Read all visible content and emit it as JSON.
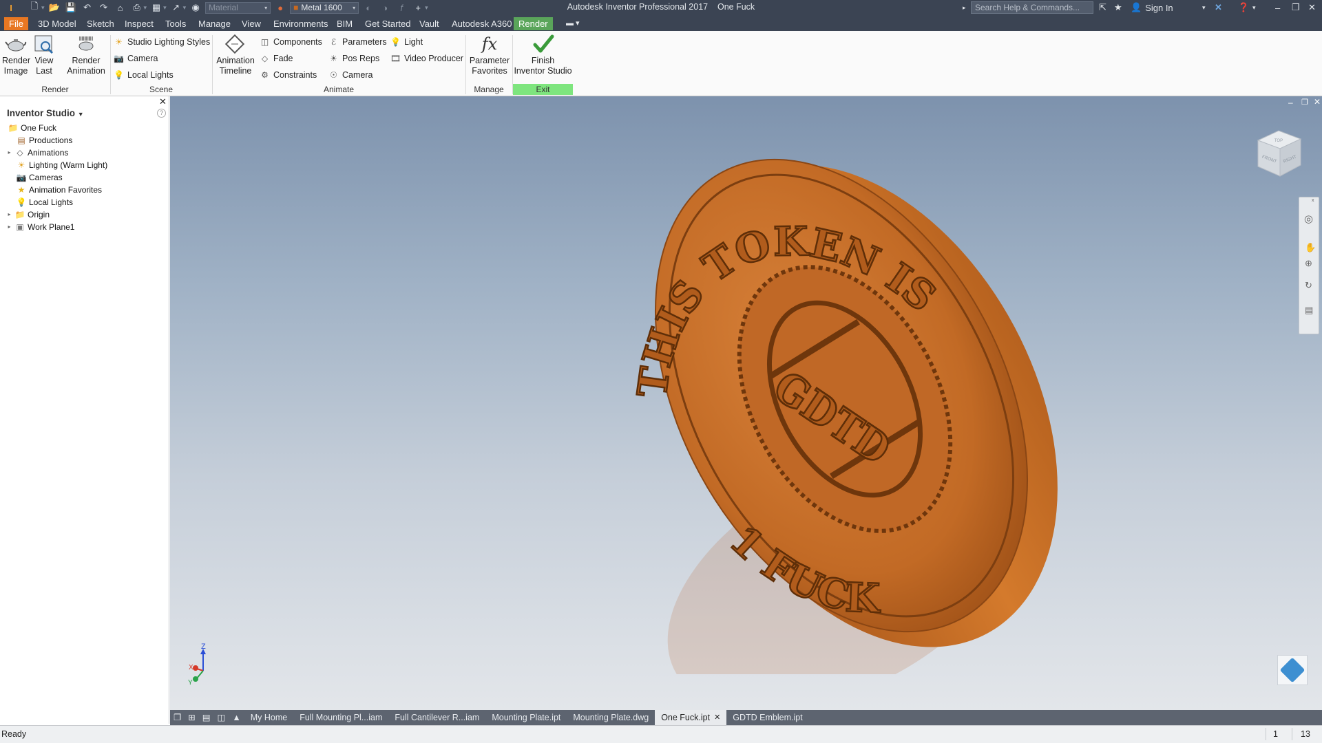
{
  "window": {
    "app_title": "Autodesk Inventor Professional 2017",
    "doc_title": "One Fuck"
  },
  "quick_access": {
    "material_placeholder": "Material",
    "appearance_value": "Metal 1600"
  },
  "search": {
    "placeholder": "Search Help & Commands..."
  },
  "account": {
    "sign_in": "Sign In"
  },
  "menu_tabs": [
    "File",
    "3D Model",
    "Sketch",
    "Inspect",
    "Tools",
    "Manage",
    "View",
    "Environments",
    "BIM",
    "Get Started",
    "Vault",
    "Autodesk A360",
    "Render"
  ],
  "active_tab": "Render",
  "ribbon": {
    "render_image": [
      "Render",
      "Image"
    ],
    "view_last": [
      "View",
      "Last"
    ],
    "render_animation": [
      "Render",
      "Animation"
    ],
    "studio_lighting_styles": "Studio Lighting Styles",
    "camera": "Camera",
    "local_lights": "Local Lights",
    "animation_timeline": [
      "Animation",
      "Timeline"
    ],
    "components": "Components",
    "fade": "Fade",
    "constraints": "Constraints",
    "parameters": "Parameters",
    "pos_reps": "Pos Reps",
    "camera_anim": "Camera",
    "light": "Light",
    "video_producer": "Video Producer",
    "parameter_favorites": [
      "Parameter",
      "Favorites"
    ],
    "finish_studio": [
      "Finish",
      "Inventor Studio"
    ],
    "panels": {
      "render": "Render",
      "scene": "Scene",
      "animate": "Animate",
      "manage": "Manage",
      "exit": "Exit"
    }
  },
  "browser": {
    "title": "Inventor Studio",
    "items": [
      {
        "label": "One Fuck",
        "icon": "folder-icon"
      },
      {
        "label": "Productions",
        "icon": "production-icon"
      },
      {
        "label": "Animations",
        "icon": "animation-icon"
      },
      {
        "label": "Lighting (Warm Light)",
        "icon": "sun-icon"
      },
      {
        "label": "Cameras",
        "icon": "camera-icon"
      },
      {
        "label": "Animation Favorites",
        "icon": "star-icon"
      },
      {
        "label": "Local Lights",
        "icon": "bulb-icon"
      },
      {
        "label": "Origin",
        "icon": "origin-folder-icon"
      },
      {
        "label": "Work Plane1",
        "icon": "plane-icon"
      }
    ]
  },
  "model": {
    "top_text": "THIS TOKEN IS",
    "bottom_text": "1 FUCK",
    "center_text": "GDTD",
    "color": "#c9691f"
  },
  "viewcube": {
    "front": "FRONT",
    "right": "RIGHT",
    "top": "TOP"
  },
  "triad": {
    "z": "Z",
    "x": "X",
    "y": "Y"
  },
  "doc_tabs": [
    "My Home",
    "Full Mounting Pl...iam",
    "Full Cantilever R...iam",
    "Mounting Plate.ipt",
    "Mounting Plate.dwg",
    "One Fuck.ipt",
    "GDTD Emblem.ipt"
  ],
  "active_doc": "One Fuck.ipt",
  "status": {
    "text": "Ready",
    "count1": "1",
    "count2": "13"
  },
  "colors": {
    "title_bar": "#3b4453",
    "file_tab": "#e87722",
    "active_tab": "#5aa55a",
    "exit_panel": "#7ee57e"
  }
}
